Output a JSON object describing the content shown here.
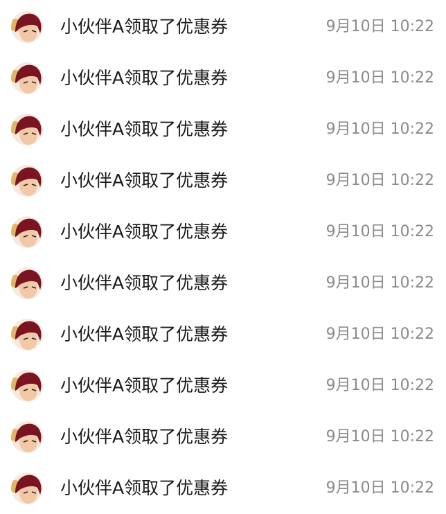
{
  "activity_list": {
    "items": [
      {
        "avatar_icon": "user-avatar-icon",
        "text": "小伙伴A领取了优惠券",
        "time": "9月10日 10:22"
      },
      {
        "avatar_icon": "user-avatar-icon",
        "text": "小伙伴A领取了优惠券",
        "time": "9月10日 10:22"
      },
      {
        "avatar_icon": "user-avatar-icon",
        "text": "小伙伴A领取了优惠券",
        "time": "9月10日 10:22"
      },
      {
        "avatar_icon": "user-avatar-icon",
        "text": "小伙伴A领取了优惠券",
        "time": "9月10日 10:22"
      },
      {
        "avatar_icon": "user-avatar-icon",
        "text": "小伙伴A领取了优惠券",
        "time": "9月10日 10:22"
      },
      {
        "avatar_icon": "user-avatar-icon",
        "text": "小伙伴A领取了优惠券",
        "time": "9月10日 10:22"
      },
      {
        "avatar_icon": "user-avatar-icon",
        "text": "小伙伴A领取了优惠券",
        "time": "9月10日 10:22"
      },
      {
        "avatar_icon": "user-avatar-icon",
        "text": "小伙伴A领取了优惠券",
        "time": "9月10日 10:22"
      },
      {
        "avatar_icon": "user-avatar-icon",
        "text": "小伙伴A领取了优惠券",
        "time": "9月10日 10:22"
      },
      {
        "avatar_icon": "user-avatar-icon",
        "text": "小伙伴A领取了优惠券",
        "time": "9月10日 10:22"
      }
    ]
  },
  "colors": {
    "background": "#ffffff",
    "text_primary": "#1a1a1a",
    "text_secondary": "#8a8a8a",
    "avatar_hair": "#7a1420",
    "avatar_skin": "#f1c9a8",
    "avatar_ring": "#d9a441"
  }
}
